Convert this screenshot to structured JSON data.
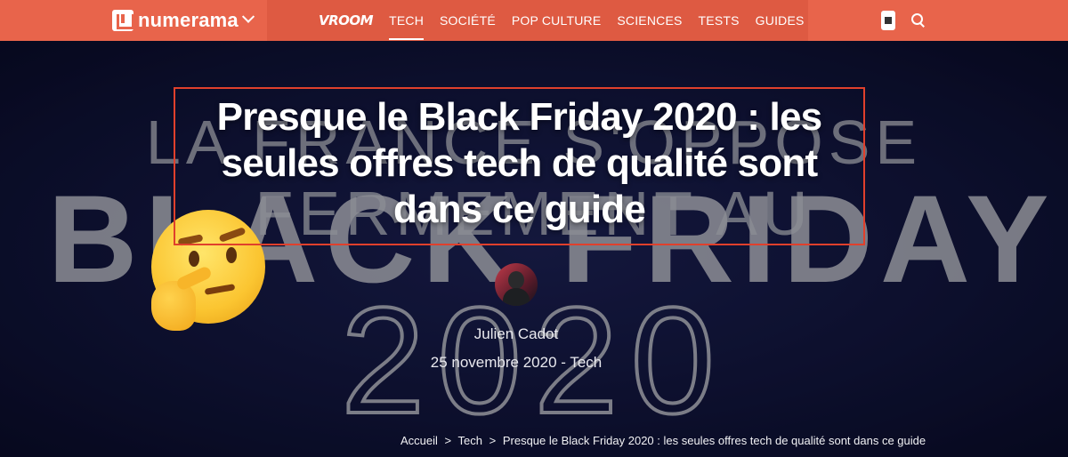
{
  "header": {
    "brand": "numerama",
    "nav": [
      {
        "label": "VROOM"
      },
      {
        "label": "TECH",
        "active": true
      },
      {
        "label": "SOCIÉTÉ"
      },
      {
        "label": "POP CULTURE"
      },
      {
        "label": "SCIENCES"
      },
      {
        "label": "TESTS"
      },
      {
        "label": "GUIDES"
      }
    ]
  },
  "hero": {
    "background_text": {
      "line1": "LA FRANCE S'OPPOSE FERMEMENT AU",
      "line2": "BLACK FRIDAY",
      "line3": "2020"
    },
    "title": "Presque le Black Friday 2020 : les seules offres tech de qualité sont dans ce guide",
    "author": "Julien Cadot",
    "date_line": "25 novembre 2020 - Tech"
  },
  "breadcrumb": {
    "items": [
      "Accueil",
      ">",
      "Tech",
      ">",
      "Presque le Black Friday 2020 : les seules offres tech de qualité sont dans ce guide"
    ]
  },
  "colors": {
    "header": "#e8644b",
    "hero_bg": "#12163f",
    "title_box": "#e0402c"
  },
  "icons": {
    "brand": "numerama-logo-icon",
    "chevron": "chevron-down-icon",
    "device": "device-icon",
    "search": "search-icon",
    "emoji": "thinking-face-emoji"
  }
}
